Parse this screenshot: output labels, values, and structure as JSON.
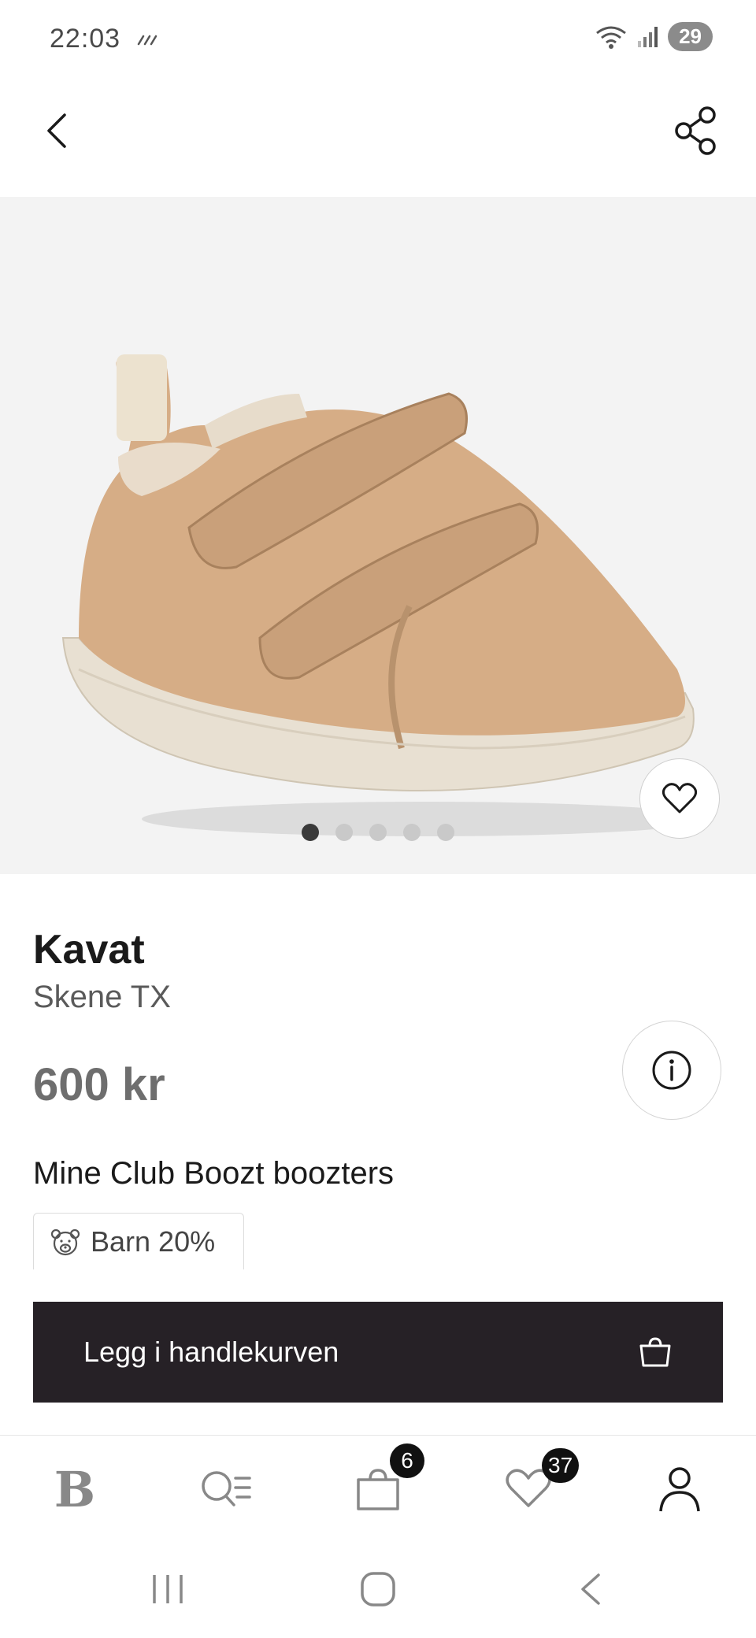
{
  "status_bar": {
    "time": "22:03",
    "battery": "29",
    "icons": [
      "signal-slash-icon",
      "wifi-icon",
      "cell-signal-icon",
      "battery-icon"
    ]
  },
  "top_nav": {
    "back_icon": "chevron-left-icon",
    "share_icon": "share-icon"
  },
  "gallery": {
    "image": "beige-velcro-sneaker",
    "dots_total": 5,
    "active_dot": 0
  },
  "product": {
    "brand": "Kavat",
    "name": "Skene TX",
    "price": "600 kr"
  },
  "club": {
    "heading": "Mine Club Boozt boozters",
    "chip_label": "Barn 20%",
    "chip_icon": "teddy-bear-icon"
  },
  "cart": {
    "label": "Legg i handlekurven",
    "icon": "shopping-bag-icon"
  },
  "tabs": [
    {
      "name": "home",
      "label": "B"
    },
    {
      "name": "search",
      "icon": "search-list-icon"
    },
    {
      "name": "bag",
      "icon": "bag-icon",
      "badge": "6"
    },
    {
      "name": "wishlist",
      "icon": "heart-icon",
      "badge": "37"
    },
    {
      "name": "account",
      "icon": "person-icon"
    }
  ],
  "colors": {
    "cart_bar": "#262126",
    "badge": "#111111",
    "image_bg": "#f3f3f3"
  }
}
